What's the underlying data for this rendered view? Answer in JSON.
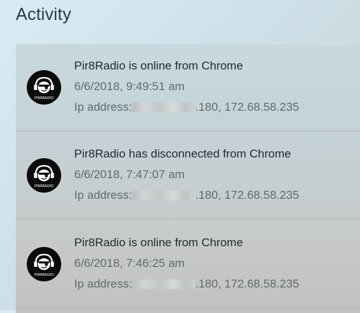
{
  "header": {
    "title": "Activity"
  },
  "activity": {
    "items": [
      {
        "avatar_text": "PIR8RADIO",
        "message": "Pir8Radio is online from Chrome",
        "timestamp": "6/6/2018, 9:49:51 am",
        "ip_label": "Ip address:",
        "ip_value": ".180, 172.68.58.235"
      },
      {
        "avatar_text": "PIR8RADIO",
        "message": "Pir8Radio has disconnected from Chrome",
        "timestamp": "6/6/2018, 7:47:07 am",
        "ip_label": "Ip address:",
        "ip_value": ".180, 172.68.58.235"
      },
      {
        "avatar_text": "PIR8RADIO",
        "message": "Pir8Radio is online from Chrome",
        "timestamp": "6/6/2018, 7:46:25 am",
        "ip_label": "Ip address:",
        "ip_value": ".180, 172.68.58.235"
      }
    ]
  },
  "icons": {
    "avatar": "pirate-headphones-logo-icon"
  },
  "colors": {
    "title": "#2b3a44",
    "message": "#1f2a30",
    "secondary": "#5f6b70",
    "avatar_bg": "#0b0b0b"
  }
}
